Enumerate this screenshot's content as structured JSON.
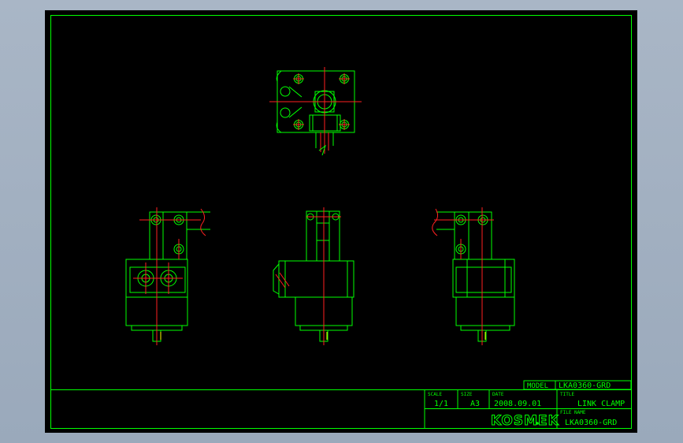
{
  "title_block": {
    "model_label": "MODEL",
    "model_value": "LKA0360-GRD",
    "scale_label": "SCALE",
    "scale_value": "1/1",
    "size_label": "SIZE",
    "size_value": "A3",
    "date_label": "DATE",
    "date_value": "2008.09.01",
    "title_label": "TITLE",
    "title_value": "LINK CLAMP",
    "file_label": "FILE NAME",
    "file_value": "LKA0360-GRD",
    "company": "KOSMEK"
  },
  "colors": {
    "background": "#000000",
    "line": "#00ff00",
    "centerline": "#ff2020",
    "detail": "#d8d8d8",
    "frame_outside": "#a9b6c6"
  }
}
